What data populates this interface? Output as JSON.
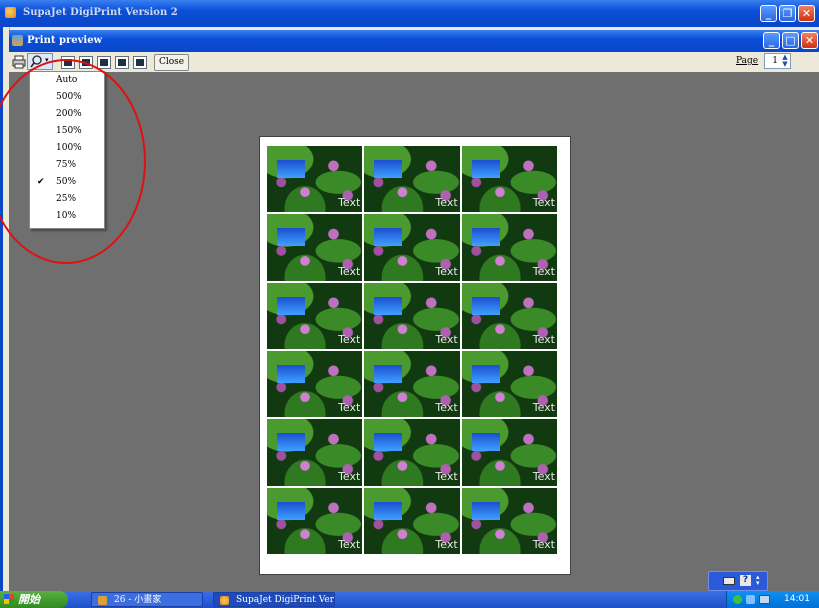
{
  "outer_window": {
    "title": "SupaJet DigiPrint Version 2"
  },
  "inner_window": {
    "title": "Print preview"
  },
  "toolbar": {
    "close_label": "Close",
    "page_label": "Page",
    "page_value": "1"
  },
  "zoom_menu": {
    "items": [
      {
        "label": "Auto",
        "checked": false
      },
      {
        "label": "500%",
        "checked": false
      },
      {
        "label": "200%",
        "checked": false
      },
      {
        "label": "150%",
        "checked": false
      },
      {
        "label": "100%",
        "checked": false
      },
      {
        "label": "75%",
        "checked": false
      },
      {
        "label": "50%",
        "checked": true
      },
      {
        "label": "25%",
        "checked": false
      },
      {
        "label": "10%",
        "checked": false
      }
    ],
    "check_glyph": "✔"
  },
  "preview": {
    "label_text": "Text",
    "columns": 3,
    "rows": 6
  },
  "taskbar": {
    "start_label": "開始",
    "tasks": [
      {
        "label": "26 - 小畫家"
      },
      {
        "label": "SupaJet DigiPrint Versi..."
      }
    ],
    "clock": "14:01"
  },
  "colors": {
    "annotation": "#e01010",
    "titlebar": "#0a4fd8",
    "preview_bg": "#6f6f6f"
  }
}
